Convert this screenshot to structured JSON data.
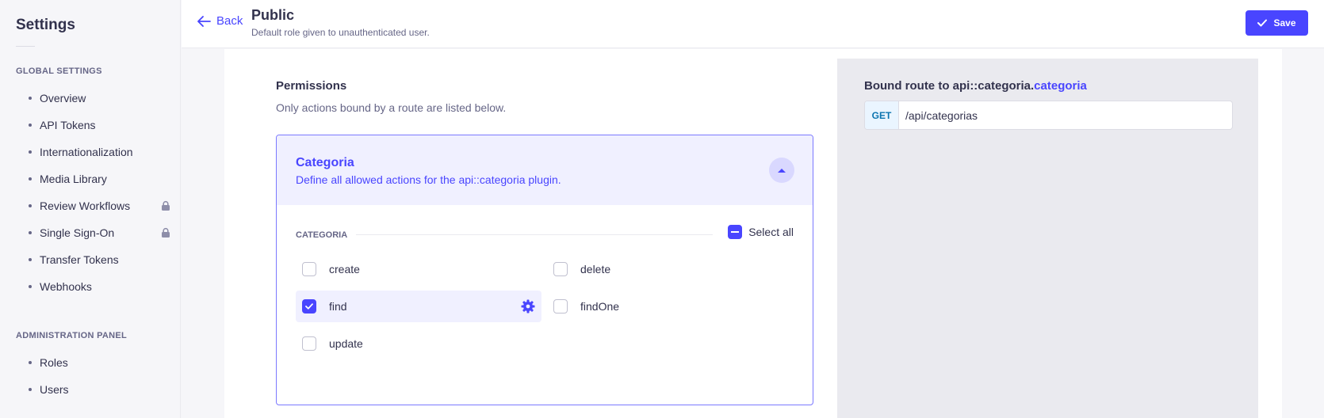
{
  "sidebar": {
    "title": "Settings",
    "sections": [
      {
        "label": "GLOBAL SETTINGS",
        "items": [
          {
            "label": "Overview",
            "locked": false
          },
          {
            "label": "API Tokens",
            "locked": false
          },
          {
            "label": "Internationalization",
            "locked": false
          },
          {
            "label": "Media Library",
            "locked": false
          },
          {
            "label": "Review Workflows",
            "locked": true
          },
          {
            "label": "Single Sign-On",
            "locked": true
          },
          {
            "label": "Transfer Tokens",
            "locked": false
          },
          {
            "label": "Webhooks",
            "locked": false
          }
        ]
      },
      {
        "label": "ADMINISTRATION PANEL",
        "items": [
          {
            "label": "Roles",
            "locked": false
          },
          {
            "label": "Users",
            "locked": false
          }
        ]
      }
    ]
  },
  "header": {
    "back_label": "Back",
    "title": "Public",
    "subtitle": "Default role given to unauthenticated user.",
    "save_label": "Save"
  },
  "permissions": {
    "title": "Permissions",
    "description": "Only actions bound by a route are listed below.",
    "accordion": {
      "title": "Categoria",
      "description": "Define all allowed actions for the api::categoria plugin.",
      "expanded": true,
      "group_label": "CATEGORIA",
      "select_all_label": "Select all",
      "select_all_state": "indeterminate",
      "actions": [
        {
          "label": "create",
          "checked": false
        },
        {
          "label": "delete",
          "checked": false
        },
        {
          "label": "find",
          "checked": true
        },
        {
          "label": "findOne",
          "checked": false
        },
        {
          "label": "update",
          "checked": false
        }
      ]
    }
  },
  "route": {
    "title_prefix": "Bound route to api::categoria.",
    "title_accent": "categoria",
    "method": "GET",
    "path": "/api/categorias"
  },
  "colors": {
    "accent": "#4945ff",
    "accent_light": "#f0f0ff",
    "get_method": "#0c75af"
  },
  "icons": [
    "arrow-left-icon",
    "check-icon",
    "lock-icon",
    "chevron-up-icon",
    "minus-icon",
    "gear-icon"
  ]
}
